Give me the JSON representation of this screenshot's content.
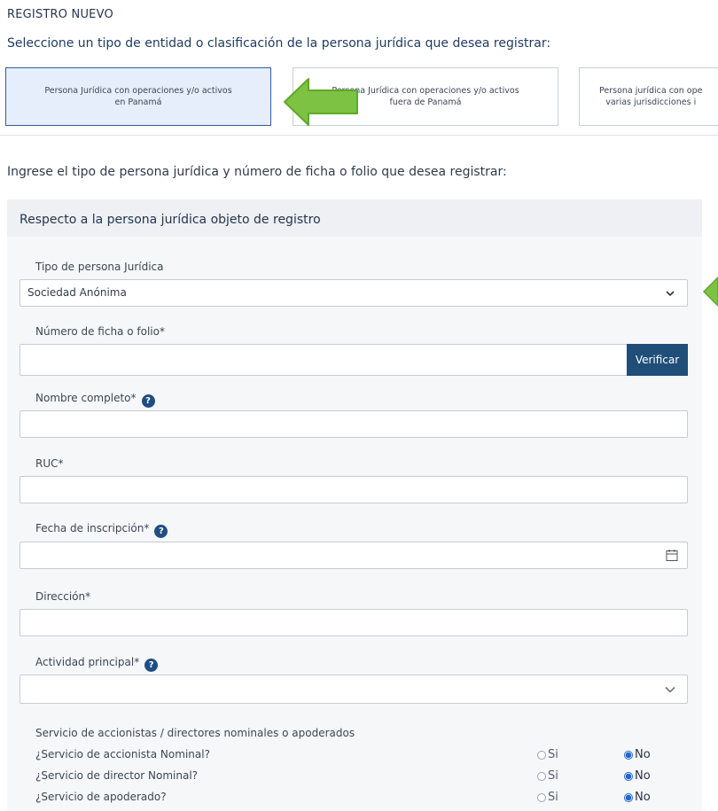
{
  "page": {
    "title": "REGISTRO NUEVO",
    "select_prompt": "Seleccione un tipo de entidad o clasificación de la persona jurídica que desea registrar:"
  },
  "entity_types": [
    {
      "label": "Persona Jurídica con operaciones y/o activos\nen Panamá",
      "selected": true
    },
    {
      "label": "Persona Jurídica con operaciones y/o activos\nfuera de Panamá",
      "selected": false
    },
    {
      "label": "Persona jurídica con ope\nvarias jurisdicciones i",
      "selected": false
    }
  ],
  "registry_prompt": "Ingrese el tipo de persona jurídica y número de ficha o folio que desea registrar:",
  "panel": {
    "title": "Respecto a la persona jurídica objeto de registro"
  },
  "form": {
    "tipo_label": "Tipo de persona Jurídica",
    "tipo_value": "Sociedad Anónima",
    "ficha_label": "Número de ficha o folio*",
    "ficha_value": "",
    "verify_label": "Verificar",
    "nombre_label": "Nombre completo*",
    "nombre_value": "",
    "ruc_label": "RUC*",
    "ruc_value": "",
    "fecha_label": "Fecha de inscripción*",
    "fecha_value": "",
    "direccion_label": "Dirección*",
    "direccion_value": "",
    "actividad_label": "Actividad principal*",
    "actividad_value": "",
    "help_glyph": "?"
  },
  "nominal_services": {
    "heading": "Servicio de accionistas / directores nominales o apoderados",
    "yes_label": "Si",
    "no_label": "No",
    "questions": [
      {
        "text": "¿Servicio de accionista Nominal?",
        "value": "No"
      },
      {
        "text": "¿Servicio de director Nominal?",
        "value": "No"
      },
      {
        "text": "¿Servicio de apoderado?",
        "value": "No"
      }
    ]
  },
  "colors": {
    "accent": "#1f4e79",
    "selected_card": "#e6eefb",
    "arrow": "#7dc243"
  },
  "icons": [
    "arrow-left-icon",
    "chevron-down-icon",
    "help-icon",
    "calendar-icon"
  ]
}
